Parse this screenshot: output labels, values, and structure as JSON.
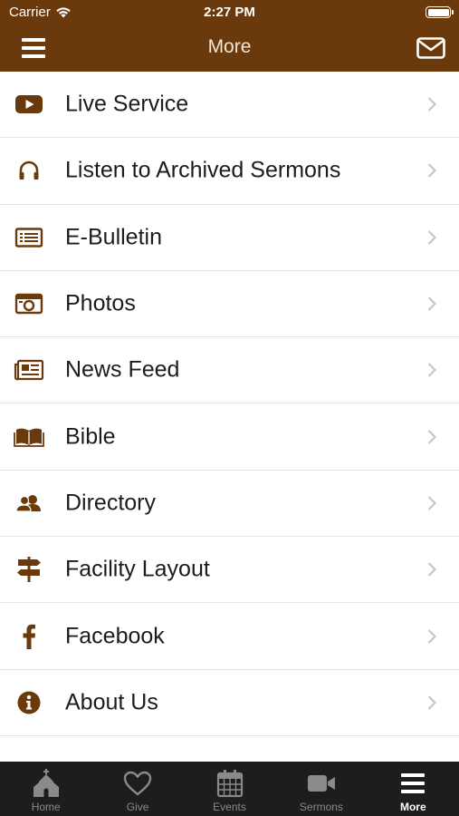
{
  "status_bar": {
    "carrier": "Carrier",
    "time": "2:27 PM",
    "battery_level": 1.0
  },
  "nav": {
    "title": "More",
    "menu_icon": "hamburger-icon",
    "mail_icon": "envelope-icon"
  },
  "colors": {
    "header_bg": "#6b3a0c",
    "icon_brown": "#6b3a0c",
    "tab_bar_bg": "#1d1d1d",
    "chevron": "#c7c7cc"
  },
  "menu_items": [
    {
      "label": "Live Service",
      "icon": "youtube-play-icon"
    },
    {
      "label": "Listen to Archived Sermons",
      "icon": "headphones-icon"
    },
    {
      "label": "E-Bulletin",
      "icon": "list-icon"
    },
    {
      "label": "Photos",
      "icon": "camera-icon"
    },
    {
      "label": "News Feed",
      "icon": "newspaper-icon"
    },
    {
      "label": "Bible",
      "icon": "open-book-icon"
    },
    {
      "label": "Directory",
      "icon": "people-icon"
    },
    {
      "label": "Facility Layout",
      "icon": "signpost-icon"
    },
    {
      "label": "Facebook",
      "icon": "facebook-icon"
    },
    {
      "label": "About Us",
      "icon": "info-icon"
    }
  ],
  "tabs": [
    {
      "label": "Home",
      "icon": "church-icon",
      "active": false
    },
    {
      "label": "Give",
      "icon": "heart-icon",
      "active": false
    },
    {
      "label": "Events",
      "icon": "calendar-icon",
      "active": false
    },
    {
      "label": "Sermons",
      "icon": "video-camera-icon",
      "active": false
    },
    {
      "label": "More",
      "icon": "hamburger-icon",
      "active": true
    }
  ]
}
